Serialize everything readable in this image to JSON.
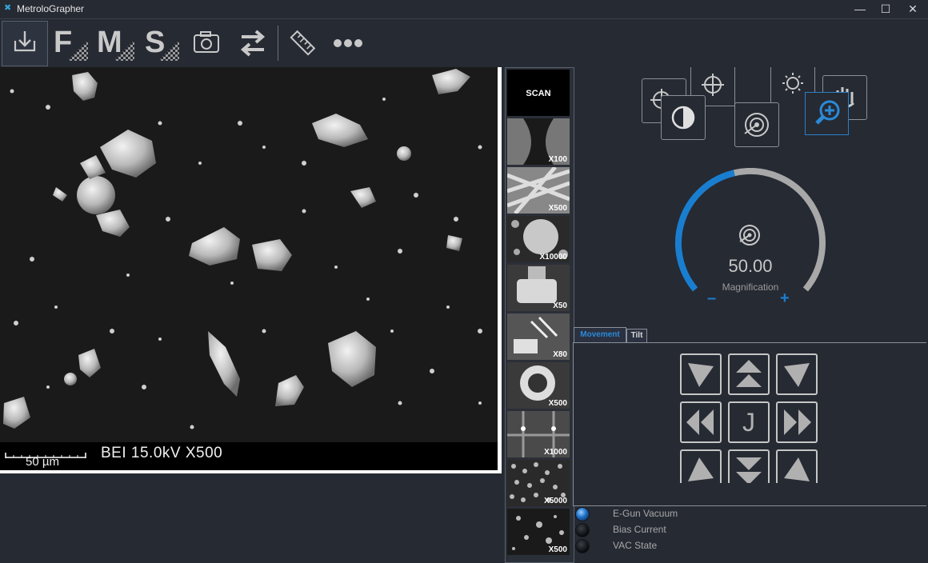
{
  "window": {
    "title": "MetroloGrapher",
    "minimize": "—",
    "maximize": "☐",
    "close": "✕"
  },
  "toolbar": {
    "download": "download-icon",
    "f_letter": "F",
    "m_letter": "M",
    "s_letter": "S",
    "camera": "camera-icon",
    "swap": "swap-arrows-icon",
    "ruler": "ruler-icon",
    "more": "more-dots-icon"
  },
  "sem": {
    "meta": "BEI  15.0kV  X500",
    "scale_label": "50 µm"
  },
  "thumbnails": [
    {
      "label": "SCAN"
    },
    {
      "label": "X100"
    },
    {
      "label": "X500"
    },
    {
      "label": "X10000"
    },
    {
      "label": "X50"
    },
    {
      "label": "X80"
    },
    {
      "label": "X500"
    },
    {
      "label": "X1000"
    },
    {
      "label": "X5000"
    },
    {
      "label": "X500"
    }
  ],
  "magnification": {
    "value": "50.00",
    "label": "Magnification",
    "minus": "–",
    "plus": "+",
    "level": 0.45,
    "accent": "#1a7ed0"
  },
  "movement": {
    "tab_movement": "Movement",
    "tab_tilt": "Tilt",
    "center_label": "J"
  },
  "status": [
    {
      "label": "E-Gun Vacuum",
      "state": "on"
    },
    {
      "label": "Bias Current",
      "state": "off"
    },
    {
      "label": "VAC State",
      "state": "off"
    }
  ]
}
